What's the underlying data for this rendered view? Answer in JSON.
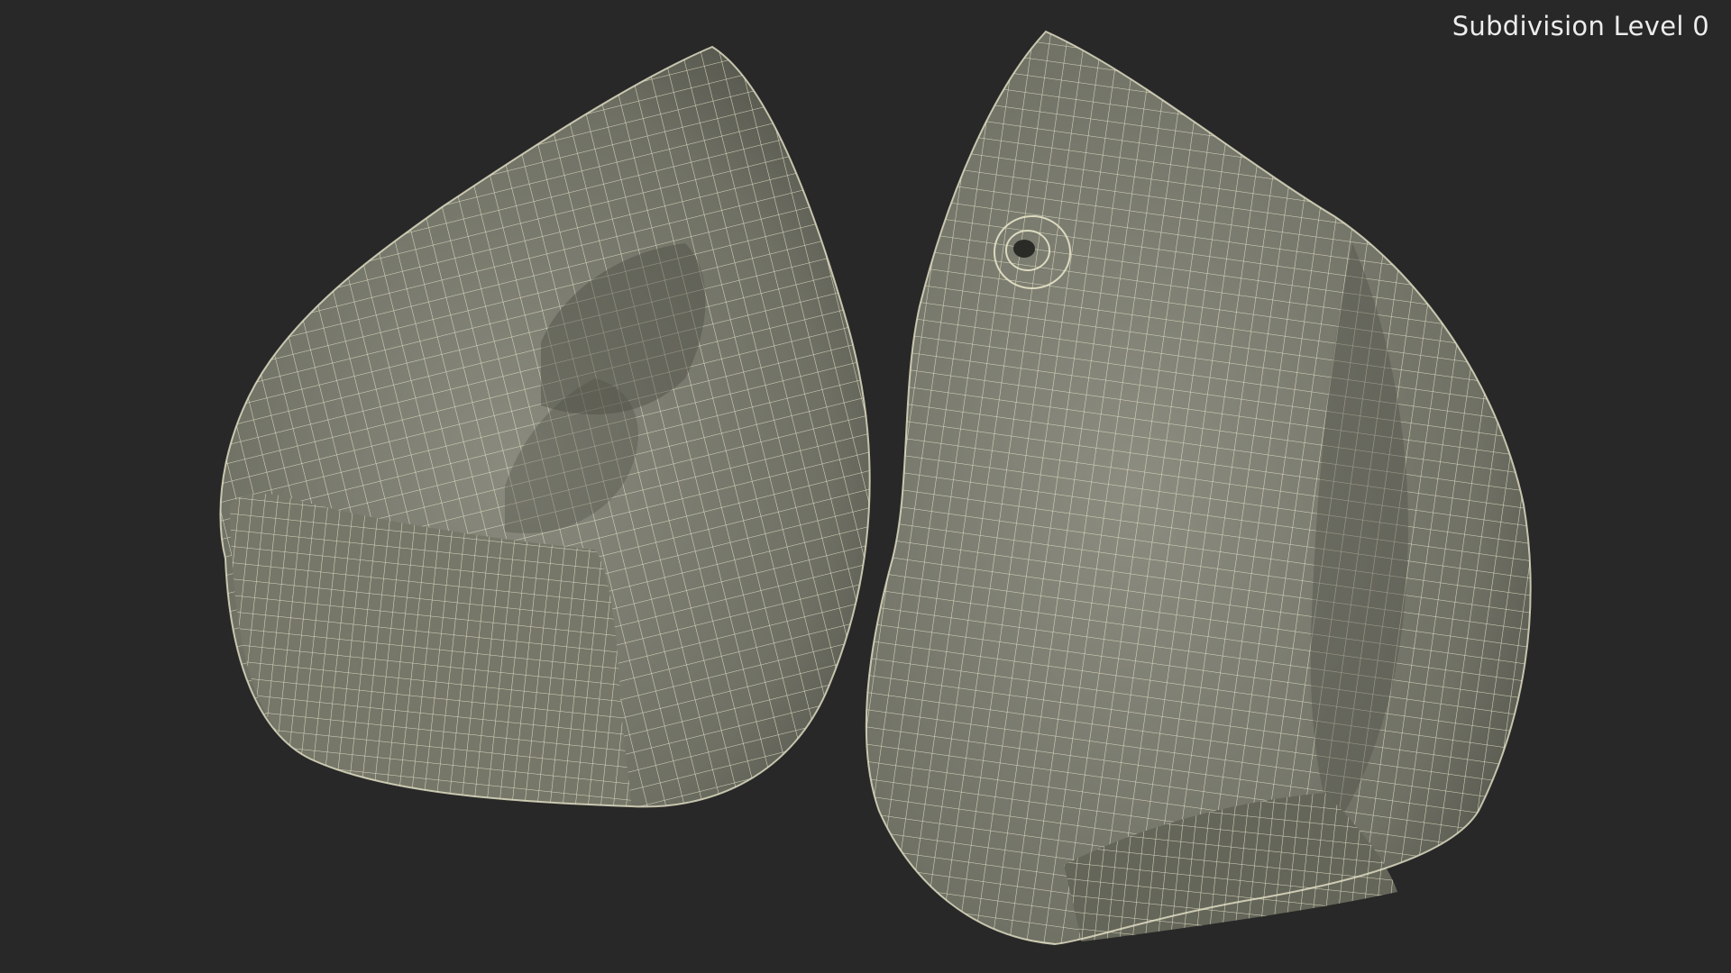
{
  "viewport": {
    "subdivision_label": "Subdivision Level 0",
    "background_color": "#282828",
    "mesh_fill_color": "#7b7c6f",
    "wireframe_color": "#e6e3c8"
  }
}
